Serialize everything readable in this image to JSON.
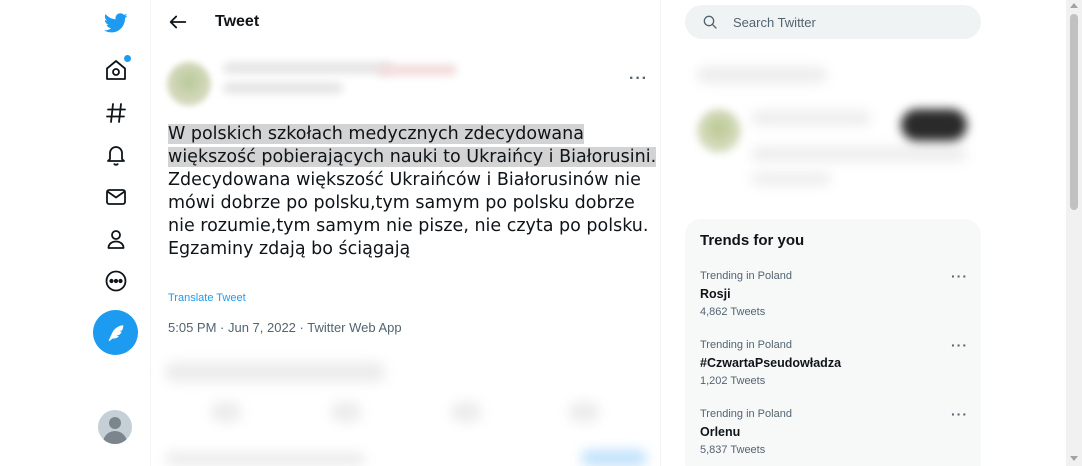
{
  "nav": {
    "icons": [
      "twitter-logo-icon",
      "home-icon",
      "explore-hash-icon",
      "notifications-bell-icon",
      "messages-mail-icon",
      "profile-person-icon",
      "more-circle-icon"
    ],
    "compose_icon": "feather-compose-icon",
    "accent_color": "#1d9bf0"
  },
  "header": {
    "title": "Tweet"
  },
  "tweet": {
    "text_highlighted": "W polskich szkołach medycznych zdecydowana większość pobierających nauki to Ukraińcy i Białorusini.",
    "text_rest": " Zdecydowana większość Ukraińców i Białorusinów nie mówi dobrze po polsku,tym samym po polsku dobrze nie rozumie,tym samym nie pisze, nie czyta po polsku.",
    "text_last": "Egzaminy zdają bo ściągają",
    "translate": "Translate Tweet",
    "meta": "5:05 PM · Jun 7, 2022 · Twitter Web App",
    "more": "···"
  },
  "search": {
    "placeholder": "Search Twitter"
  },
  "trends": {
    "title": "Trends for you",
    "items": [
      {
        "context": "Trending in Poland",
        "name": "Rosji",
        "count": "4,862 Tweets"
      },
      {
        "context": "Trending in Poland",
        "name": "#CzwartaPseudowładza",
        "count": "1,202 Tweets"
      },
      {
        "context": "Trending in Poland",
        "name": "Orlenu",
        "count": "5,837 Tweets"
      }
    ],
    "more": "···"
  }
}
